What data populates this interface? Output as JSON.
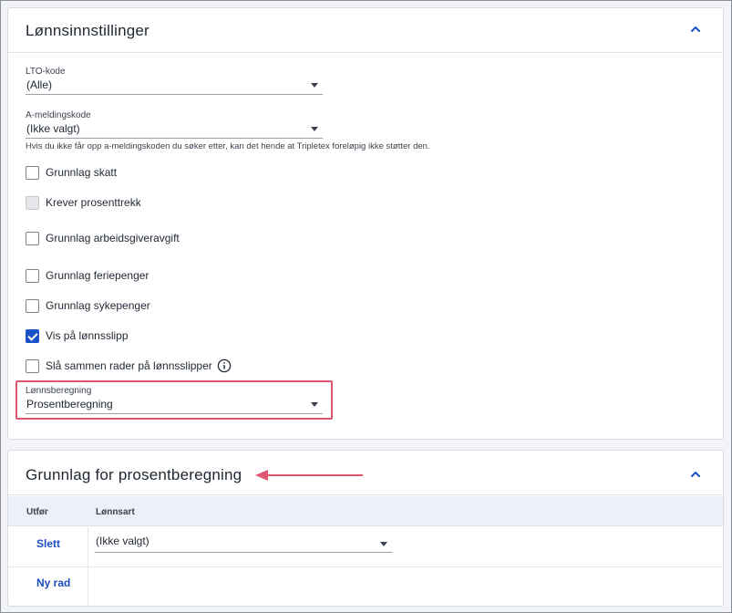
{
  "salary_settings": {
    "title": "Lønnsinnstillinger",
    "lto_code": {
      "label": "LTO-kode",
      "value": "(Alle)"
    },
    "a_message_code": {
      "label": "A-meldingskode",
      "value": "(Ikke valgt)",
      "hint": "Hvis du ikke får opp a-meldingskoden du søker etter, kan det hende at Tripletex foreløpig ikke støtter den."
    },
    "checkboxes": [
      {
        "label": "Grunnlag skatt"
      },
      {
        "label": "Krever prosenttrekk"
      },
      {
        "label": "Grunnlag arbeidsgiveravgift"
      },
      {
        "label": "Grunnlag feriepenger"
      },
      {
        "label": "Grunnlag sykepenger"
      },
      {
        "label": "Vis på lønnsslipp"
      },
      {
        "label": "Slå sammen rader på lønnsslipper"
      }
    ],
    "salary_calculation": {
      "label": "Lønnsberegning",
      "value": "Prosentberegning"
    }
  },
  "percent_basis": {
    "title": "Grunnlag for prosentberegning",
    "columns": {
      "action": "Utfør",
      "wage_type": "Lønnsart"
    },
    "rows": [
      {
        "action": "Slett",
        "wage_type": "(Ikke valgt)"
      }
    ],
    "new_row": "Ny rad"
  },
  "colors": {
    "accent": "#1a52c8",
    "highlight": "#e0566e"
  }
}
